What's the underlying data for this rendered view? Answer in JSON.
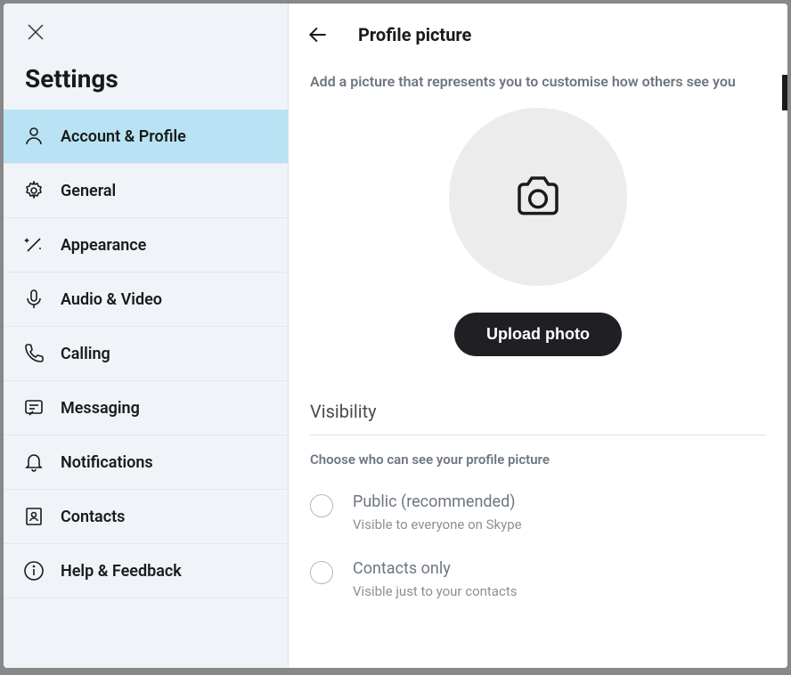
{
  "sidebar": {
    "title": "Settings",
    "items": [
      {
        "label": "Account & Profile",
        "icon": "person-icon",
        "active": true
      },
      {
        "label": "General",
        "icon": "gear-icon",
        "active": false
      },
      {
        "label": "Appearance",
        "icon": "wand-icon",
        "active": false
      },
      {
        "label": "Audio & Video",
        "icon": "mic-icon",
        "active": false
      },
      {
        "label": "Calling",
        "icon": "phone-icon",
        "active": false
      },
      {
        "label": "Messaging",
        "icon": "message-icon",
        "active": false
      },
      {
        "label": "Notifications",
        "icon": "bell-icon",
        "active": false
      },
      {
        "label": "Contacts",
        "icon": "contacts-icon",
        "active": false
      },
      {
        "label": "Help & Feedback",
        "icon": "info-icon",
        "active": false
      }
    ]
  },
  "main": {
    "title": "Profile picture",
    "subtitle": "Add a picture that represents you to customise how others see you",
    "upload_label": "Upload photo",
    "visibility": {
      "heading": "Visibility",
      "sub": "Choose who can see your profile picture",
      "options": [
        {
          "label": "Public (recommended)",
          "desc": "Visible to everyone on Skype",
          "selected": false
        },
        {
          "label": "Contacts only",
          "desc": "Visible just to your contacts",
          "selected": false
        }
      ]
    }
  }
}
